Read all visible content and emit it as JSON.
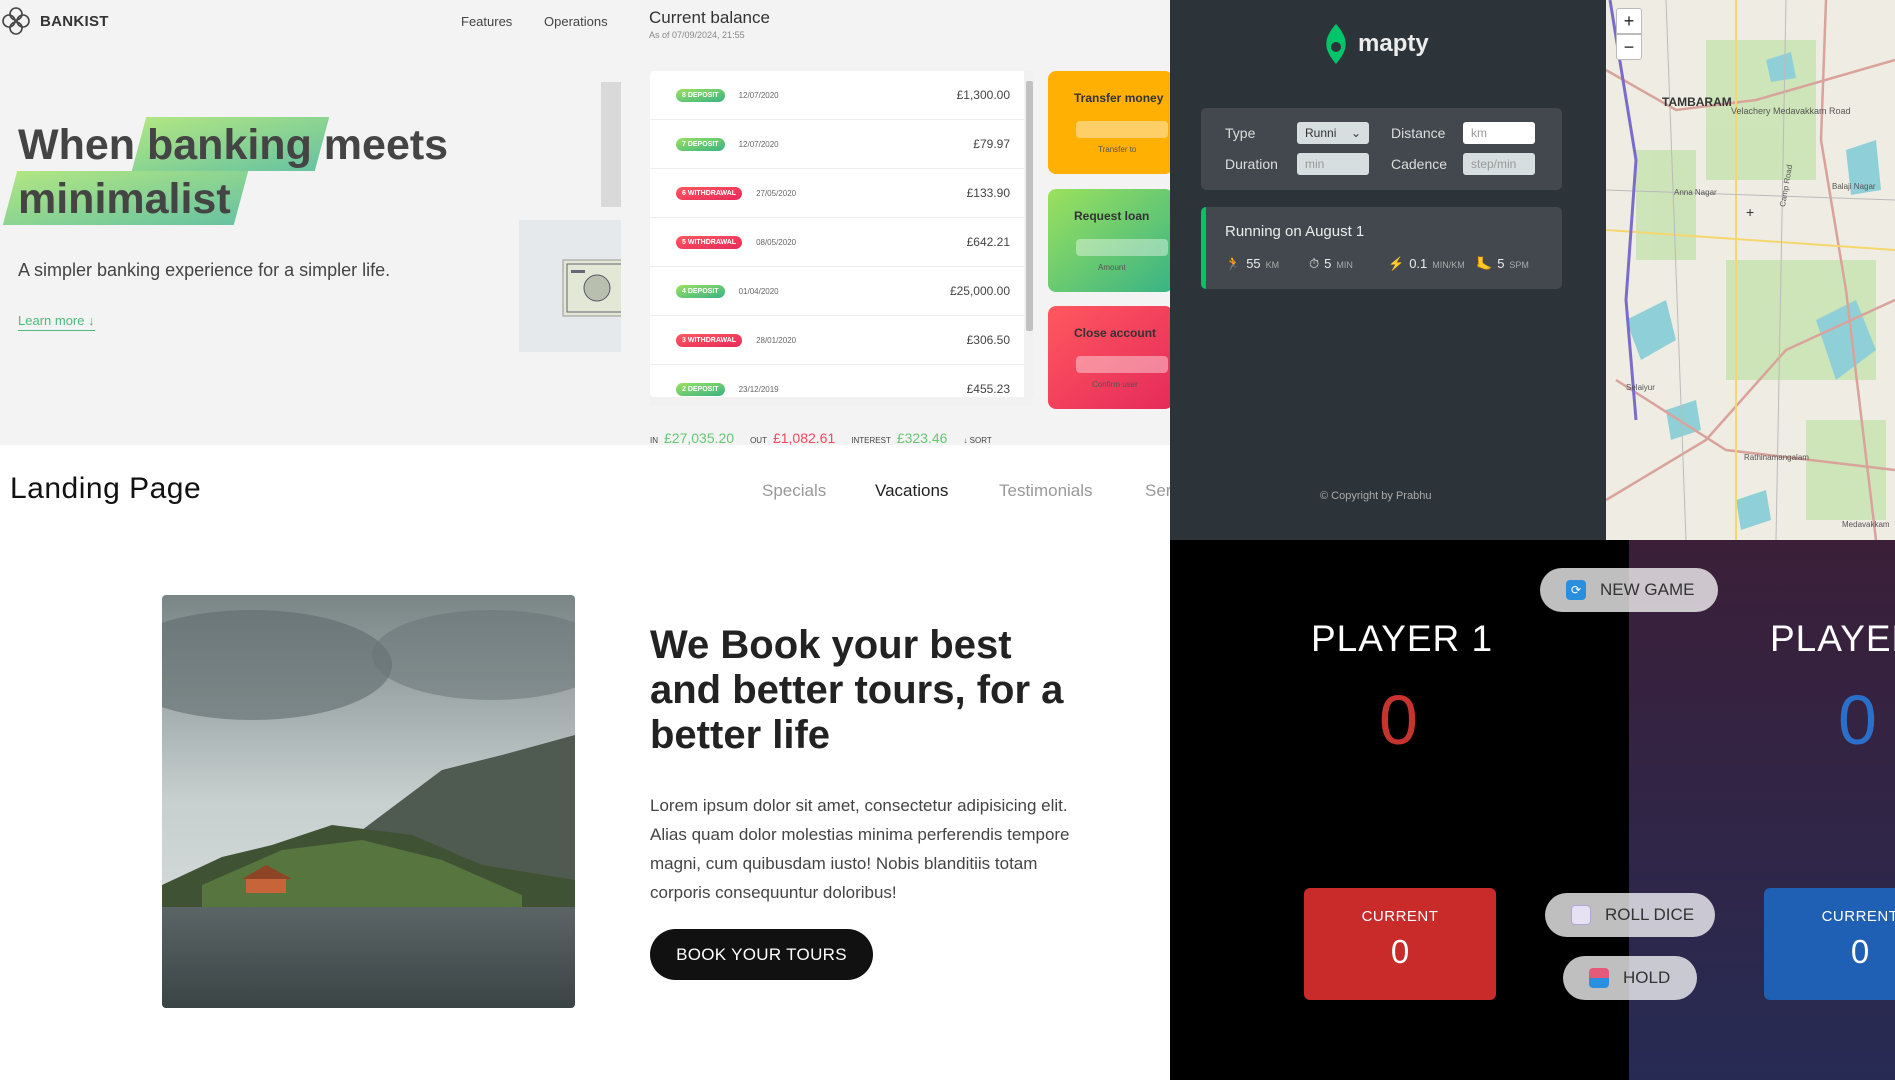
{
  "bankist": {
    "logo": "BANKIST",
    "nav": [
      "Features",
      "Operations"
    ],
    "headline_1": "When",
    "headline_2": "banking",
    "headline_3": "meets",
    "headline_4": "minimalist",
    "subtitle": "A simpler banking experience for a simpler life.",
    "learn_more": "Learn more ↓"
  },
  "bankapp": {
    "balance_title": "Current balance",
    "balance_date": "As of 07/09/2024, 21:55",
    "movements": [
      {
        "type": "8 deposit",
        "kind": "dep",
        "date": "12/07/2020",
        "value": "£1,300.00"
      },
      {
        "type": "7 deposit",
        "kind": "dep",
        "date": "12/07/2020",
        "value": "£79.97"
      },
      {
        "type": "6 withdrawal",
        "kind": "wd",
        "date": "27/05/2020",
        "value": "£133.90"
      },
      {
        "type": "5 withdrawal",
        "kind": "wd",
        "date": "08/05/2020",
        "value": "£642.21"
      },
      {
        "type": "4 deposit",
        "kind": "dep",
        "date": "01/04/2020",
        "value": "£25,000.00"
      },
      {
        "type": "3 withdrawal",
        "kind": "wd",
        "date": "28/01/2020",
        "value": "£306.50"
      },
      {
        "type": "2 deposit",
        "kind": "dep",
        "date": "23/12/2019",
        "value": "£455.23"
      }
    ],
    "transfer": {
      "title": "Transfer money",
      "label": "Transfer to",
      "color": "#ffb003"
    },
    "loan": {
      "title": "Request loan",
      "label": "Amount",
      "color": "#39b385"
    },
    "close": {
      "title": "Close account",
      "label": "Confirm user",
      "color": "#e52a5a"
    },
    "summary": {
      "in_label": "IN",
      "in_value": "£27,035.20",
      "out_label": "OUT",
      "out_value": "£1,082.61",
      "interest_label": "INTEREST",
      "interest_value": "£323.46",
      "sort_label": "↓ SORT"
    }
  },
  "mapty": {
    "brand": "mapty",
    "form": {
      "type_label": "Type",
      "type_value": "Runni",
      "distance_label": "Distance",
      "distance_placeholder": "km",
      "duration_label": "Duration",
      "duration_placeholder": "min",
      "cadence_label": "Cadence",
      "cadence_placeholder": "step/min"
    },
    "workout": {
      "title": "Running on August 1",
      "distance": "55",
      "distance_unit": "KM",
      "duration": "5",
      "duration_unit": "MIN",
      "pace": "0.1",
      "pace_unit": "MIN/KM",
      "cadence": "5",
      "cadence_unit": "SPM"
    },
    "copyright": "© Copyright by Prabhu",
    "map": {
      "zoom_in": "+",
      "zoom_out": "−",
      "place_tambaram": "TAMBARAM",
      "place_velachery": "Velachery Medavakkam Road",
      "place_anna": "Anna Nagar",
      "place_rathinam": "Rathinamangalam",
      "place_camp": "Camp Road",
      "place_balaji": "Balaji Nagar",
      "place_selaiyur": "Selaiyur",
      "place_medavakkam": "Medavakkam"
    }
  },
  "landing": {
    "title": "Landing Page",
    "nav": [
      "Specials",
      "Vacations",
      "Testimonials",
      "Ser"
    ],
    "heading": "We Book your best and better tours, for a better life",
    "paragraph": "Lorem ipsum dolor sit amet, consectetur adipisicing elit. Alias quam dolor molestias minima perferendis tempore magni, cum quibusdam iusto! Nobis blanditiis totam corporis consequuntur doloribus!",
    "button": "BOOK YOUR TOURS"
  },
  "pig": {
    "new_game": "NEW GAME",
    "player1": {
      "name": "PLAYER 1",
      "score": "0",
      "current_label": "CURRENT",
      "current": "0"
    },
    "player2": {
      "name": "PLAYER",
      "score": "0",
      "current_label": "CURRENT",
      "current": "0"
    },
    "roll": "ROLL DICE",
    "hold": "HOLD",
    "colors": {
      "p1_score": "#c7332f",
      "p2_score": "#2a6fc9",
      "p1_current": "#c92a2a",
      "p2_current": "#1f5fb4"
    }
  }
}
